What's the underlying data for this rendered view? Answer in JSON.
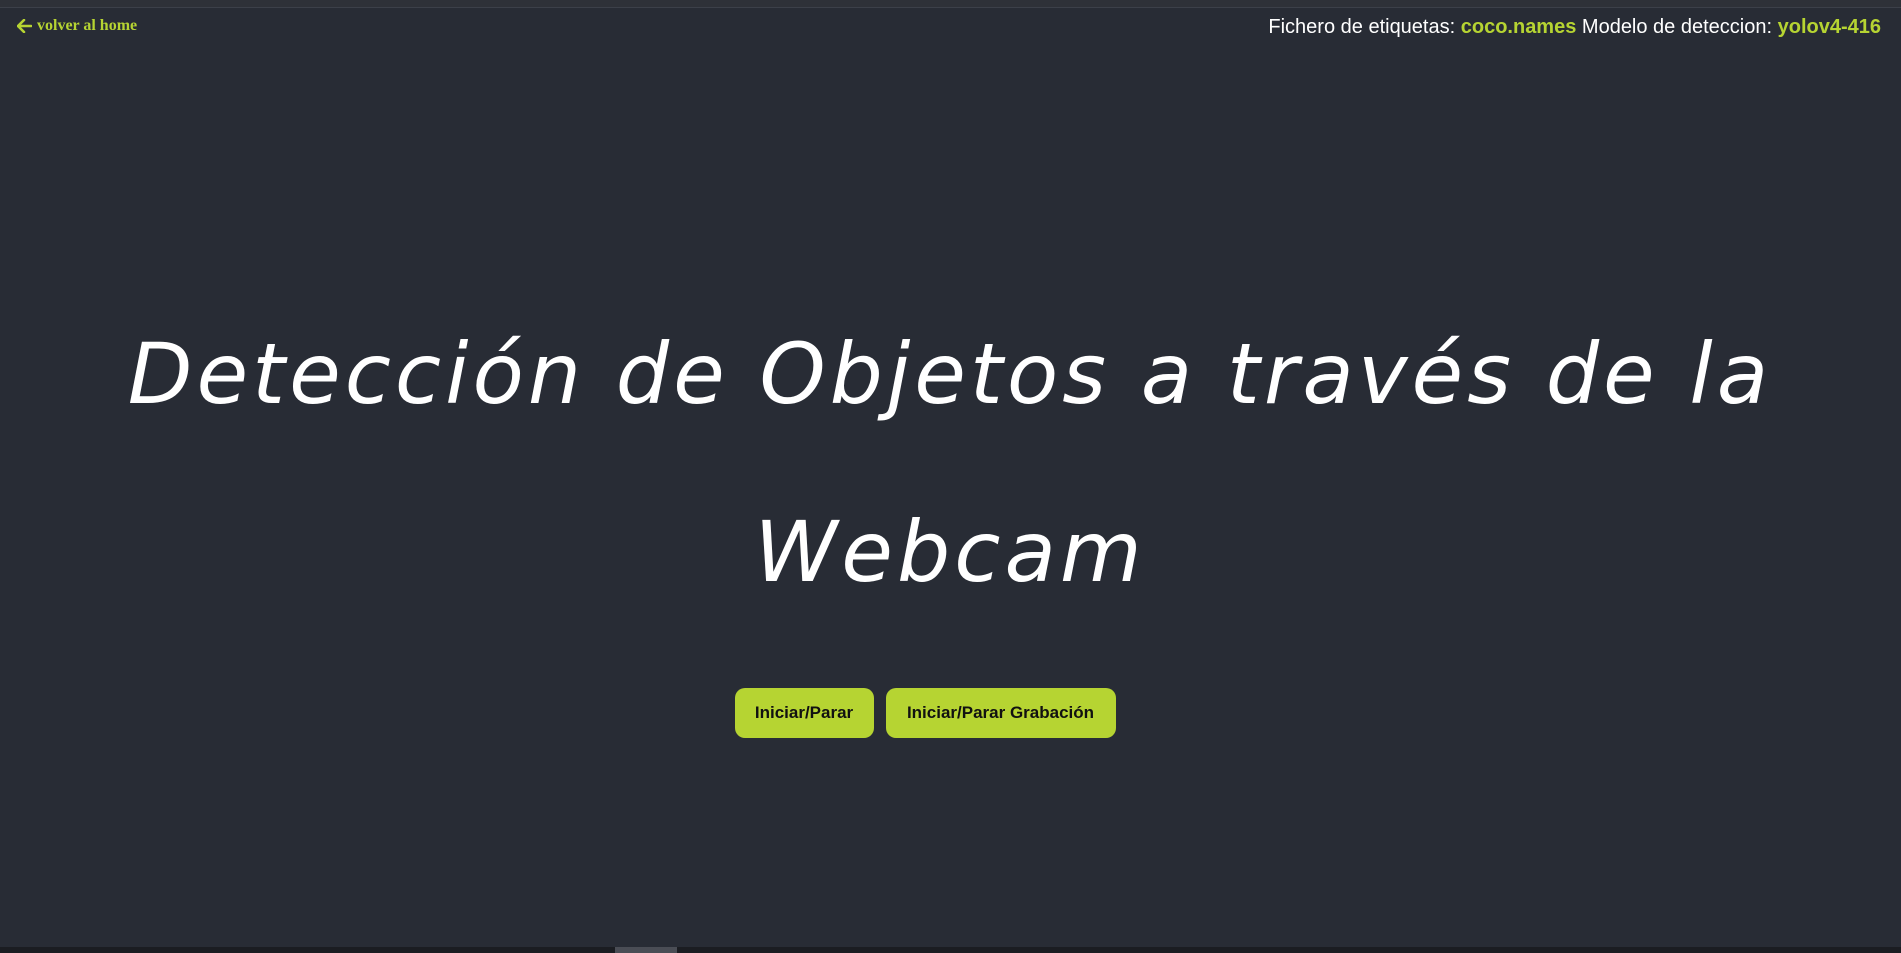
{
  "nav": {
    "back_label": "volver al home",
    "back_icon": "arrow-left-icon"
  },
  "info": {
    "labels_prefix": "Fichero de etiquetas:",
    "labels_file": "coco.names",
    "model_prefix": "Modelo de deteccion:",
    "model_name": "yolov4-416"
  },
  "hero": {
    "title_line1": "Detección de Objetos a través de la",
    "title_line2": "Webcam"
  },
  "actions": {
    "start_stop_label": "Iniciar/Parar",
    "record_label": "Iniciar/Parar Grabación"
  },
  "colors": {
    "background": "#282c35",
    "accent": "#b6d432",
    "text": "#ffffff"
  }
}
